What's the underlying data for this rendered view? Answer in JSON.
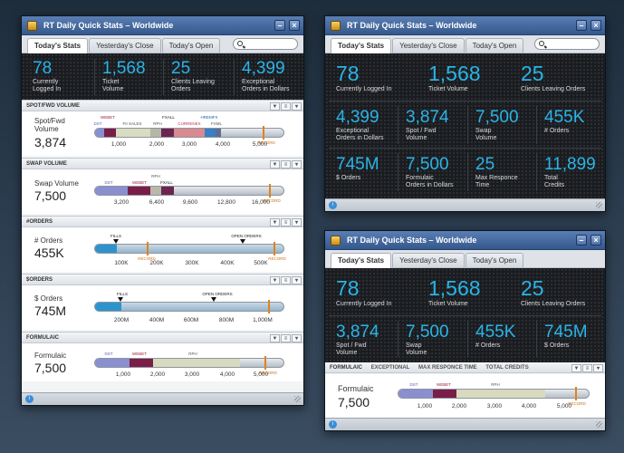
{
  "window": {
    "title": "RT Daily Quick Stats",
    "subtitle": "Worldwide",
    "min": "–",
    "close": "×"
  },
  "tabs": [
    "Today's Stats",
    "Yesterday's Close",
    "Today's Open"
  ],
  "left": {
    "kpis": [
      {
        "value": "78",
        "label": "Currently\nLogged In"
      },
      {
        "value": "1,568",
        "label": "Ticket\nVolume"
      },
      {
        "value": "25",
        "label": "Clients Leaving\nOrders"
      },
      {
        "value": "4,399",
        "label": "Exceptional\nOrders in Dollars"
      }
    ],
    "sections": [
      {
        "header": "SPOT/FWD VOLUME",
        "label": "Spot/Fwd\nVolume",
        "value": "3,874",
        "ticks": [
          "1,000",
          "2,000",
          "3,000",
          "4,000",
          "5,000"
        ],
        "record": "RECORD",
        "markers": [
          "WEBET",
          "DST",
          "FII SALES",
          "RPH",
          "FXALL",
          "CURRENEX",
          "HREMFX",
          "FXML"
        ]
      },
      {
        "header": "SWAP VOLUME",
        "label": "Swap Volume",
        "value": "7,500",
        "ticks": [
          "3,200",
          "6,400",
          "9,600",
          "12,800",
          "16,000"
        ],
        "record": "RECORD",
        "markers": [
          "DST",
          "WEBET",
          "RPH",
          "FXALL"
        ]
      },
      {
        "header": "#ORDERS",
        "label": "# Orders",
        "value": "455K",
        "ticks": [
          "100K",
          "200K",
          "300K",
          "400K",
          "500K"
        ],
        "record": "RECORD",
        "markers": [
          "FILLS",
          "OPEN ORDERS"
        ]
      },
      {
        "header": "$ORDERS",
        "label": "$ Orders",
        "value": "745M",
        "ticks": [
          "200M",
          "400M",
          "600M",
          "800M",
          "1,000M"
        ],
        "record": "RECORD",
        "markers": [
          "FILLS",
          "OPEN ORDERS"
        ]
      },
      {
        "header": "FORMULAIC",
        "label": "Formulaic",
        "value": "7,500",
        "ticks": [
          "1,000",
          "2,000",
          "3,000",
          "4,000",
          "5,000"
        ],
        "record": "RECORD",
        "markers": [
          "DST",
          "WEBET",
          "RPH"
        ]
      }
    ]
  },
  "top_right": {
    "kpis": [
      {
        "value": "78",
        "label": "Currently Logged In"
      },
      {
        "value": "1,568",
        "label": "Ticket Volume"
      },
      {
        "value": "25",
        "label": "Clients Leaving Orders"
      },
      {
        "value": "4,399",
        "label": "Exceptional\nOrders in Dollars"
      },
      {
        "value": "3,874",
        "label": "Spot / Fwd\nVolume"
      },
      {
        "value": "7,500",
        "label": "Swap\nVolume"
      },
      {
        "value": "455K",
        "label": "# Orders"
      },
      {
        "value": "745M",
        "label": "$ Orders"
      },
      {
        "value": "7,500",
        "label": "Formulaic\nOrders in Dollars"
      },
      {
        "value": "25",
        "label": "Max Responce\nTime"
      },
      {
        "value": "11,899",
        "label": "Total\nCredits"
      }
    ]
  },
  "bottom_right": {
    "kpis": [
      {
        "value": "78",
        "label": "Currently Logged In"
      },
      {
        "value": "1,568",
        "label": "Ticket Volume"
      },
      {
        "value": "25",
        "label": "Clients Leaving Orders"
      },
      {
        "value": "3,874",
        "label": "Spot / Fwd\nVolume"
      },
      {
        "value": "7,500",
        "label": "Swap\nVolume"
      },
      {
        "value": "455K",
        "label": "# Orders"
      },
      {
        "value": "745M",
        "label": "$ Orders"
      }
    ],
    "subtabs": [
      "FORMULAIC",
      "EXCEPTIONAL",
      "MAX RESPONCE TIME",
      "TOTAL CREDITS"
    ],
    "section": {
      "label": "Formulaic",
      "value": "7,500",
      "ticks": [
        "1,000",
        "2,000",
        "3,000",
        "4,000",
        "5,000"
      ],
      "record": "RECORD",
      "markers": [
        "DST",
        "WEBET",
        "RPH"
      ]
    }
  },
  "colors": {
    "accent": "#2ab4e8",
    "record": "#e0821e"
  }
}
